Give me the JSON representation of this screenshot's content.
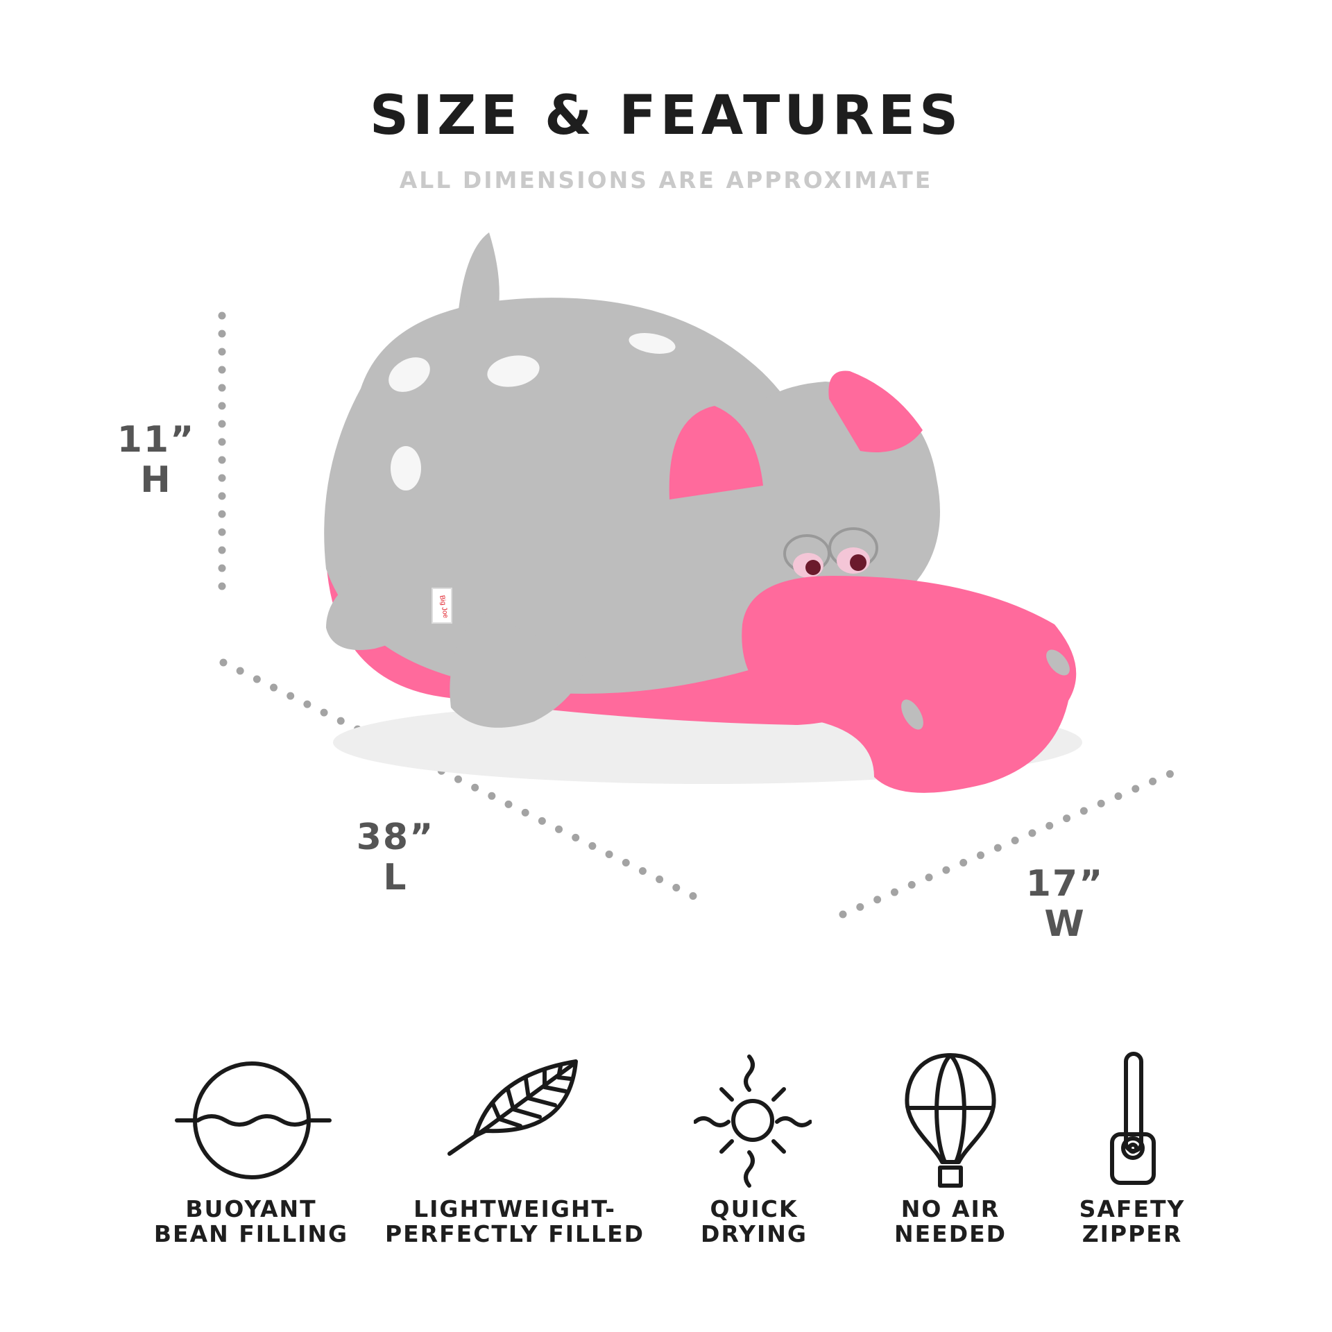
{
  "header": {
    "title": "SIZE & FEATURES",
    "subtitle": "ALL DIMENSIONS ARE APPROXIMATE"
  },
  "dimensions": {
    "height": {
      "value": "11”",
      "axis": "H"
    },
    "length": {
      "value": "38”",
      "axis": "L"
    },
    "width": {
      "value": "17”",
      "axis": "W"
    }
  },
  "product": {
    "description_icon": "hippo-bean-bag-icon",
    "tag_text": "Big Joe",
    "colors": {
      "body": "#b9b9b9",
      "accent": "#ff6a9c",
      "dots": "#a9a9a9"
    }
  },
  "features": [
    {
      "icon": "buoyant-bean-icon",
      "line1": "BUOYANT",
      "line2": "BEAN FILLING"
    },
    {
      "icon": "feather-leaf-icon",
      "line1": "LIGHTWEIGHT-",
      "line2": "PERFECTLY FILLED"
    },
    {
      "icon": "sun-icon",
      "line1": "QUICK",
      "line2": "DRYING"
    },
    {
      "icon": "hot-air-balloon-icon",
      "line1": "NO AIR",
      "line2": "NEEDED"
    },
    {
      "icon": "zipper-icon",
      "line1": "SAFETY",
      "line2": "ZIPPER"
    }
  ]
}
